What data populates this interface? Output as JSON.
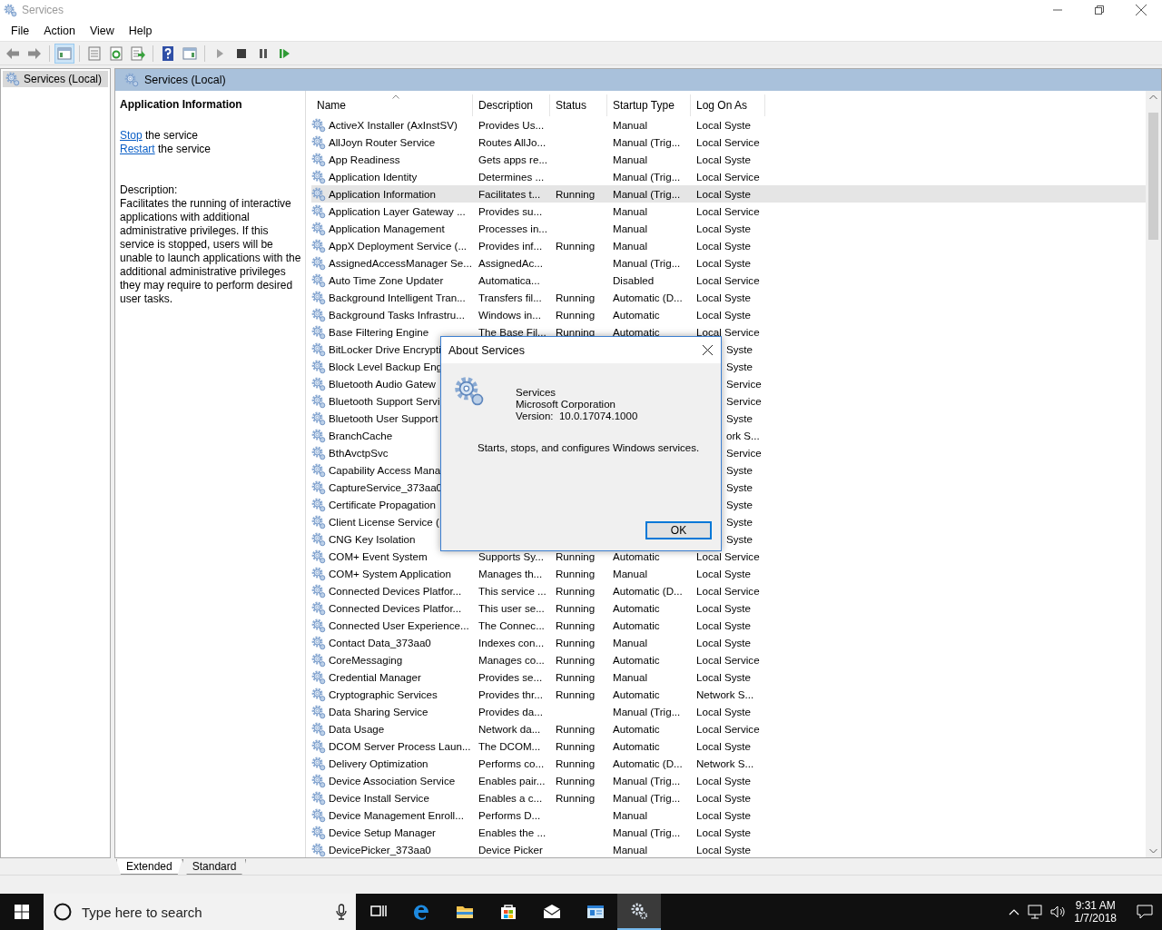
{
  "window": {
    "title": "Services"
  },
  "menu": [
    "File",
    "Action",
    "View",
    "Help"
  ],
  "toolbar": [
    {
      "kind": "back",
      "pressed": false
    },
    {
      "kind": "forward",
      "pressed": false
    },
    {
      "kind": "tree-toggle",
      "pressed": true
    },
    {
      "kind": "properties",
      "pressed": false
    },
    {
      "kind": "refresh",
      "pressed": false
    },
    {
      "kind": "export",
      "pressed": false
    },
    {
      "kind": "help",
      "pressed": false
    },
    {
      "kind": "action-pane",
      "pressed": false
    },
    {
      "kind": "start",
      "pressed": false
    },
    {
      "kind": "stop",
      "pressed": false
    },
    {
      "kind": "pause",
      "pressed": false
    },
    {
      "kind": "resume",
      "pressed": false
    }
  ],
  "tree": [
    {
      "label": "Services (Local)",
      "selected": true
    }
  ],
  "panel": {
    "title": "Services (Local)"
  },
  "details": {
    "heading": "Application Information",
    "actions": [
      {
        "link": "Stop",
        "text": " the service"
      },
      {
        "link": "Restart",
        "text": " the service"
      }
    ],
    "description_label": "Description:",
    "description": "Facilitates the running of interactive applications with additional administrative privileges.  If this service is stopped, users will be unable to launch applications with the additional administrative privileges they may require to perform desired user tasks."
  },
  "table": {
    "columns": [
      {
        "label": "Name",
        "sorted": true
      },
      {
        "label": "Description",
        "sorted": false
      },
      {
        "label": "Status",
        "sorted": false
      },
      {
        "label": "Startup Type",
        "sorted": false
      },
      {
        "label": "Log On As",
        "sorted": false
      }
    ],
    "rows": [
      {
        "name": "ActiveX Installer (AxInstSV)",
        "description": "Provides Us...",
        "startup": "Manual",
        "log_on": "Local Syste",
        "selected": false
      },
      {
        "name": "AllJoyn Router Service",
        "description": "Routes AllJo...",
        "startup": "Manual (Trig...",
        "log_on": "Local Service",
        "selected": false
      },
      {
        "name": "App Readiness",
        "description": "Gets apps re...",
        "startup": "Manual",
        "log_on": "Local Syste",
        "selected": false
      },
      {
        "name": "Application Identity",
        "description": "Determines ...",
        "startup": "Manual (Trig...",
        "log_on": "Local Service",
        "selected": false
      },
      {
        "name": "Application Information",
        "description": "Facilitates t...",
        "status": "Running",
        "startup": "Manual (Trig...",
        "log_on": "Local Syste",
        "selected": true
      },
      {
        "name": "Application Layer Gateway ...",
        "description": "Provides su...",
        "startup": "Manual",
        "log_on": "Local Service",
        "selected": false
      },
      {
        "name": "Application Management",
        "description": "Processes in...",
        "startup": "Manual",
        "log_on": "Local Syste",
        "selected": false
      },
      {
        "name": "AppX Deployment Service (...",
        "description": "Provides inf...",
        "status": "Running",
        "startup": "Manual",
        "log_on": "Local Syste",
        "selected": false
      },
      {
        "name": "AssignedAccessManager Se...",
        "description": "AssignedAc...",
        "startup": "Manual (Trig...",
        "log_on": "Local Syste",
        "selected": false
      },
      {
        "name": "Auto Time Zone Updater",
        "description": "Automatica...",
        "startup": "Disabled",
        "log_on": "Local Service",
        "selected": false
      },
      {
        "name": "Background Intelligent Tran...",
        "description": "Transfers fil...",
        "status": "Running",
        "startup": "Automatic (D...",
        "log_on": "Local Syste",
        "selected": false
      },
      {
        "name": "Background Tasks Infrastru...",
        "description": "Windows in...",
        "status": "Running",
        "startup": "Automatic",
        "log_on": "Local Syste",
        "selected": false
      },
      {
        "name": "Base Filtering Engine",
        "description": "The Base Fil...",
        "status": "Running",
        "startup": "Automatic",
        "log_on": "Local Service",
        "selected": false
      },
      {
        "name": "BitLocker Drive Encrypti",
        "log_on": "Syste",
        "selected": false
      },
      {
        "name": "Block Level Backup Eng",
        "log_on": "Syste",
        "selected": false
      },
      {
        "name": "Bluetooth Audio Gatew",
        "log_on": "Service",
        "selected": false
      },
      {
        "name": "Bluetooth Support Servi",
        "log_on": "Service",
        "selected": false
      },
      {
        "name": "Bluetooth User Support",
        "log_on": "Syste",
        "selected": false
      },
      {
        "name": "BranchCache",
        "log_on": "ork S...",
        "selected": false
      },
      {
        "name": "BthAvctpSvc",
        "log_on": "Service",
        "selected": false
      },
      {
        "name": "Capability Access Mana",
        "log_on": "Syste",
        "selected": false
      },
      {
        "name": "CaptureService_373aa0",
        "log_on": "Syste",
        "selected": false
      },
      {
        "name": "Certificate Propagation",
        "log_on": "Syste",
        "selected": false
      },
      {
        "name": "Client License Service (",
        "log_on": "Syste",
        "selected": false
      },
      {
        "name": "CNG Key Isolation",
        "log_on": "Syste",
        "selected": false
      },
      {
        "name": "COM+ Event System",
        "description": "Supports Sy...",
        "status": "Running",
        "startup": "Automatic",
        "log_on": "Local Service",
        "selected": false
      },
      {
        "name": "COM+ System Application",
        "description": "Manages th...",
        "status": "Running",
        "startup": "Manual",
        "log_on": "Local Syste",
        "selected": false
      },
      {
        "name": "Connected Devices Platfor...",
        "description": "This service ...",
        "status": "Running",
        "startup": "Automatic (D...",
        "log_on": "Local Service",
        "selected": false
      },
      {
        "name": "Connected Devices Platfor...",
        "description": "This user se...",
        "status": "Running",
        "startup": "Automatic",
        "log_on": "Local Syste",
        "selected": false
      },
      {
        "name": "Connected User Experience...",
        "description": "The Connec...",
        "status": "Running",
        "startup": "Automatic",
        "log_on": "Local Syste",
        "selected": false
      },
      {
        "name": "Contact Data_373aa0",
        "description": "Indexes con...",
        "status": "Running",
        "startup": "Manual",
        "log_on": "Local Syste",
        "selected": false
      },
      {
        "name": "CoreMessaging",
        "description": "Manages co...",
        "status": "Running",
        "startup": "Automatic",
        "log_on": "Local Service",
        "selected": false
      },
      {
        "name": "Credential Manager",
        "description": "Provides se...",
        "status": "Running",
        "startup": "Manual",
        "log_on": "Local Syste",
        "selected": false
      },
      {
        "name": "Cryptographic Services",
        "description": "Provides thr...",
        "status": "Running",
        "startup": "Automatic",
        "log_on": "Network S...",
        "selected": false
      },
      {
        "name": "Data Sharing Service",
        "description": "Provides da...",
        "startup": "Manual (Trig...",
        "log_on": "Local Syste",
        "selected": false
      },
      {
        "name": "Data Usage",
        "description": "Network da...",
        "status": "Running",
        "startup": "Automatic",
        "log_on": "Local Service",
        "selected": false
      },
      {
        "name": "DCOM Server Process Laun...",
        "description": "The DCOM...",
        "status": "Running",
        "startup": "Automatic",
        "log_on": "Local Syste",
        "selected": false
      },
      {
        "name": "Delivery Optimization",
        "description": "Performs co...",
        "status": "Running",
        "startup": "Automatic (D...",
        "log_on": "Network S...",
        "selected": false
      },
      {
        "name": "Device Association Service",
        "description": "Enables pair...",
        "status": "Running",
        "startup": "Manual (Trig...",
        "log_on": "Local Syste",
        "selected": false
      },
      {
        "name": "Device Install Service",
        "description": "Enables a c...",
        "status": "Running",
        "startup": "Manual (Trig...",
        "log_on": "Local Syste",
        "selected": false
      },
      {
        "name": "Device Management Enroll...",
        "description": "Performs D...",
        "startup": "Manual",
        "log_on": "Local Syste",
        "selected": false
      },
      {
        "name": "Device Setup Manager",
        "description": "Enables the ...",
        "startup": "Manual (Trig...",
        "log_on": "Local Syste",
        "selected": false
      },
      {
        "name": "DevicePicker_373aa0",
        "description": "Device Picker",
        "startup": "Manual",
        "log_on": "Local Syste",
        "selected": false
      }
    ]
  },
  "view_tabs": [
    {
      "label": "Extended",
      "selected": true
    },
    {
      "label": "Standard",
      "selected": false
    }
  ],
  "dialog": {
    "title": "About Services",
    "product": "Services",
    "company": "Microsoft Corporation",
    "version": "Version:  10.0.17074.1000",
    "summary": "Starts, stops, and configures Windows services.",
    "button": "OK"
  },
  "taskbar": {
    "search_placeholder": "Type here to search",
    "apps": [
      {
        "kind": "task-view",
        "active": false
      },
      {
        "kind": "edge",
        "active": false
      },
      {
        "kind": "explorer",
        "active": false
      },
      {
        "kind": "store",
        "active": false
      },
      {
        "kind": "mail",
        "active": false
      },
      {
        "kind": "window-app",
        "active": false
      },
      {
        "kind": "services",
        "active": true
      }
    ],
    "time": "9:31 AM",
    "date": "1/7/2018"
  }
}
